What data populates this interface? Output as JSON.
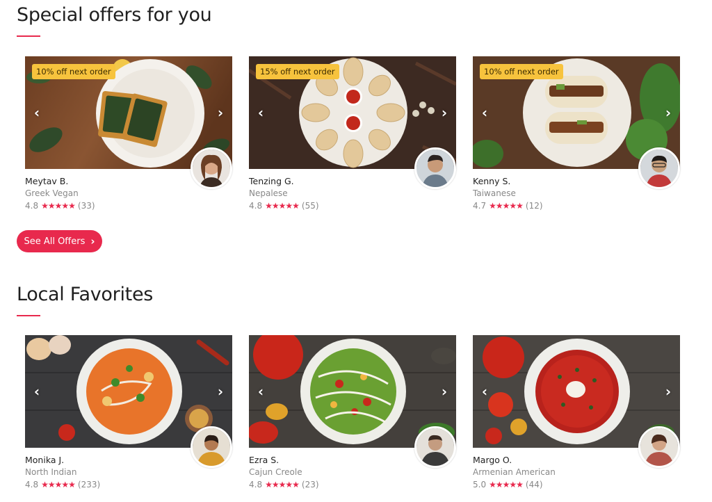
{
  "sections": [
    {
      "title": "Special offers for you",
      "cards": [
        {
          "badge": "10% off next order",
          "name": "Meytav B.",
          "cuisine": "Greek Vegan",
          "rating": "4.8",
          "stars": "★★★★★",
          "count": "(33)",
          "food": "spinach-pie",
          "avatar_color": "#8b5a3c"
        },
        {
          "badge": "15% off next order",
          "name": "Tenzing G.",
          "cuisine": "Nepalese",
          "rating": "4.8",
          "stars": "★★★★★",
          "count": "(55)",
          "food": "momo",
          "avatar_color": "#6b7b8b"
        },
        {
          "badge": "10% off next order",
          "name": "Kenny S.",
          "cuisine": "Taiwanese",
          "rating": "4.7",
          "stars": "★★★★★",
          "count": "(12)",
          "food": "gua-bao",
          "avatar_color": "#c23a3a"
        }
      ],
      "button_label": "See All Offers",
      "button_icon": "chevron-right-icon"
    },
    {
      "title": "Local Favorites",
      "cards": [
        {
          "name": "Monika J.",
          "cuisine": "North Indian",
          "rating": "4.8",
          "stars": "★★★★★",
          "count": "(233)",
          "food": "curry",
          "avatar_color": "#d89a2c"
        },
        {
          "name": "Ezra S.",
          "cuisine": "Cajun Creole",
          "rating": "4.8",
          "stars": "★★★★★",
          "count": "(23)",
          "food": "salad",
          "avatar_color": "#3a3a3a"
        },
        {
          "name": "Margo O.",
          "cuisine": "Armenian American",
          "rating": "5.0",
          "stars": "★★★★★",
          "count": "(44)",
          "food": "borscht",
          "avatar_color": "#b2554a"
        }
      ]
    }
  ],
  "arrows": {
    "prev": "‹",
    "next": "›"
  },
  "accent_color": "#e8294d",
  "badge_color": "#f7c33d"
}
